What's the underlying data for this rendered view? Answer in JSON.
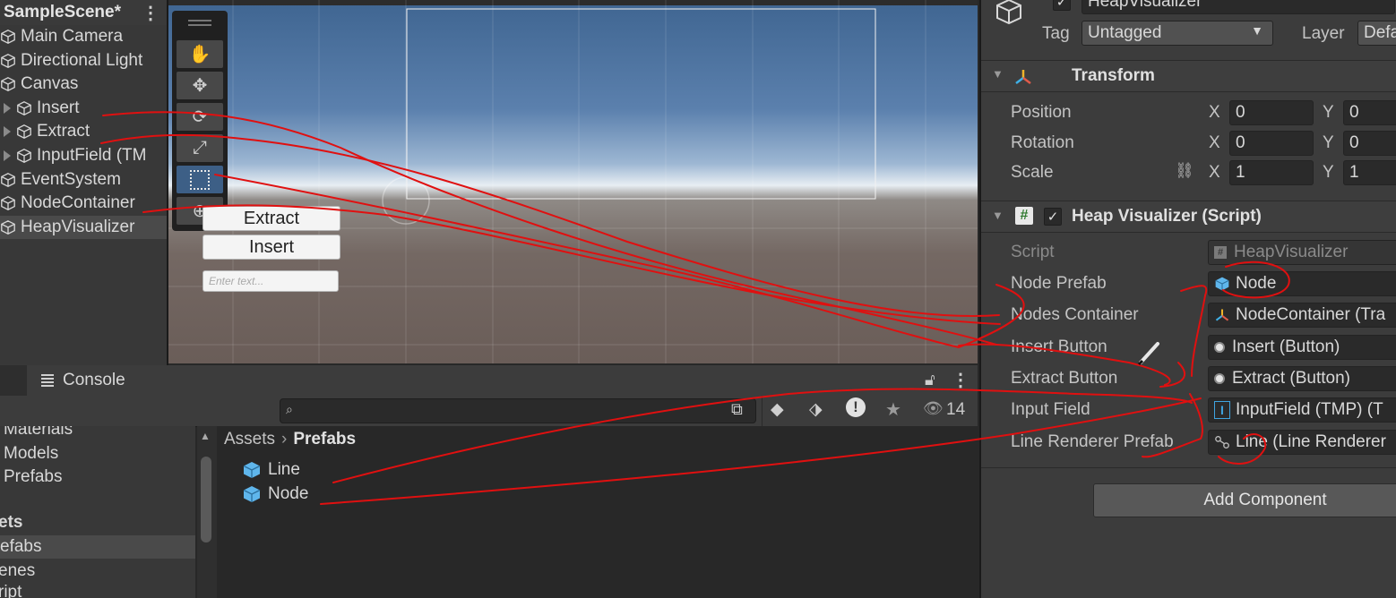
{
  "hierarchy": {
    "scene": "SampleScene*",
    "items": [
      {
        "label": "Main Camera",
        "expandable": false
      },
      {
        "label": "Directional Light",
        "expandable": false
      },
      {
        "label": "Canvas",
        "expandable": false
      },
      {
        "label": "Insert",
        "expandable": true
      },
      {
        "label": "Extract",
        "expandable": true
      },
      {
        "label": "InputField (TM",
        "expandable": true
      },
      {
        "label": "EventSystem",
        "expandable": false
      },
      {
        "label": "NodeContainer",
        "expandable": false
      },
      {
        "label": "HeapVisualizer",
        "expandable": false
      }
    ]
  },
  "scene_view": {
    "buttons": {
      "extract": "Extract",
      "insert": "Insert"
    },
    "input_placeholder": "Enter text...",
    "tools": [
      "hand-tool",
      "move-tool",
      "rotate-tool",
      "scale-tool",
      "rect-tool",
      "transform-tool"
    ]
  },
  "console": {
    "tab_label": "Console"
  },
  "project": {
    "hidden_count": "14",
    "folders": [
      "Materials",
      "Models",
      "Prefabs",
      "ets",
      "efabs",
      "enes",
      "ript"
    ],
    "breadcrumb": {
      "root": "Assets",
      "current": "Prefabs"
    },
    "assets": [
      "Line",
      "Node"
    ]
  },
  "inspector": {
    "object_name": "HeapVisualizer",
    "tag_label": "Tag",
    "tag_value": "Untagged",
    "layer_label": "Layer",
    "layer_value": "Defa",
    "transform": {
      "title": "Transform",
      "rows": [
        {
          "label": "Position",
          "x": "0",
          "y": "0"
        },
        {
          "label": "Rotation",
          "x": "0",
          "y": "0"
        },
        {
          "label": "Scale",
          "x": "1",
          "y": "1"
        }
      ],
      "x_label": "X",
      "y_label": "Y"
    },
    "script_component": {
      "title": "Heap Visualizer (Script)",
      "fields": [
        {
          "label": "Script",
          "value": "HeapVisualizer",
          "icon": "script-icon",
          "disabled": true
        },
        {
          "label": "Node Prefab",
          "value": "Node",
          "icon": "prefab-icon"
        },
        {
          "label": "Nodes Container",
          "value": "NodeContainer (Tra",
          "icon": "transform-icon"
        },
        {
          "label": "Insert Button",
          "value": "Insert (Button)",
          "icon": "object-icon"
        },
        {
          "label": "Extract Button",
          "value": "Extract (Button)",
          "icon": "object-icon"
        },
        {
          "label": "Input Field",
          "value": "InputField (TMP) (T",
          "icon": "textmesh-icon"
        },
        {
          "label": "Line Renderer Prefab",
          "value": "Line (Line Renderer",
          "icon": "line-renderer-icon"
        }
      ]
    },
    "add_component": "Add Component"
  },
  "colors": {
    "annotation": "#e01010",
    "prefab_blue": "#5fb6ec",
    "selection": "#4a4a4a"
  }
}
